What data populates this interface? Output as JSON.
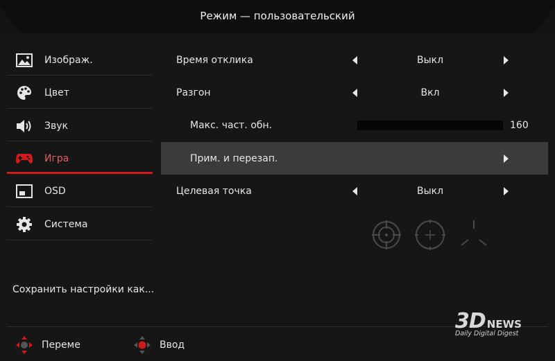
{
  "header": {
    "title": "Режим — пользовательский"
  },
  "sidebar": {
    "items": [
      {
        "label": "Изображ.",
        "icon": "image-icon"
      },
      {
        "label": "Цвет",
        "icon": "palette-icon"
      },
      {
        "label": "Звук",
        "icon": "speaker-icon"
      },
      {
        "label": "Игра",
        "icon": "gamepad-icon",
        "active": true
      },
      {
        "label": "OSD",
        "icon": "osd-icon"
      },
      {
        "label": "Система",
        "icon": "gear-icon"
      }
    ],
    "save_label": "Сохранить настройки как..."
  },
  "settings": {
    "response_time": {
      "label": "Время отклика",
      "value": "Выкл"
    },
    "overclock": {
      "label": "Разгон",
      "value": "Вкл"
    },
    "max_refresh": {
      "label": "Макс. част. обн.",
      "value": "160"
    },
    "apply_save": {
      "label": "Прим. и перезап."
    },
    "crosshair": {
      "label": "Целевая точка",
      "value": "Выкл"
    }
  },
  "footer": {
    "move_label": "Переме",
    "enter_label": "Ввод"
  },
  "watermark": {
    "brand_left": "3D",
    "brand_right": "NEWS",
    "tagline": "Daily Digital Digest"
  },
  "colors": {
    "accent": "#d21a1a",
    "highlight": "#3b3b3b",
    "background": "#161616"
  }
}
